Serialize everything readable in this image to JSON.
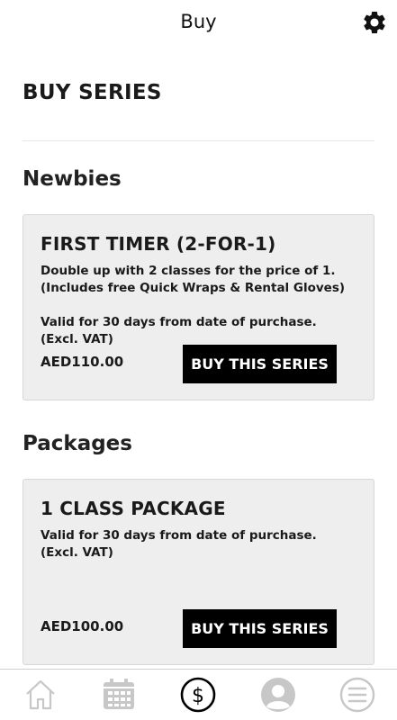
{
  "header": {
    "title": "Buy",
    "settings_icon": "gear-icon"
  },
  "page_title": "BUY SERIES",
  "sections": [
    {
      "title": "Newbies",
      "card": {
        "title": "FIRST TIMER (2-FOR-1)",
        "description_line1": "Double up with 2 classes for the price of 1.",
        "description_line2": "(Includes free Quick Wraps & Rental Gloves)",
        "validity_line1": "Valid for 30 days from date of purchase.",
        "validity_line2": "(Excl. VAT)",
        "price": "AED110.00",
        "button_label": "BUY THIS SERIES"
      }
    },
    {
      "title": "Packages",
      "card": {
        "title": "1 CLASS PACKAGE",
        "validity_line1": "Valid for 30 days from date of purchase.",
        "validity_line2": "(Excl. VAT)",
        "price": "AED100.00",
        "button_label": "BUY THIS SERIES"
      }
    }
  ],
  "tabbar": {
    "items": [
      "home-icon",
      "calendar-icon",
      "dollar-icon",
      "profile-icon",
      "menu-icon"
    ],
    "active": "dollar-icon",
    "colors": {
      "active": "#000000",
      "inactive": "#c7c7c7"
    }
  }
}
